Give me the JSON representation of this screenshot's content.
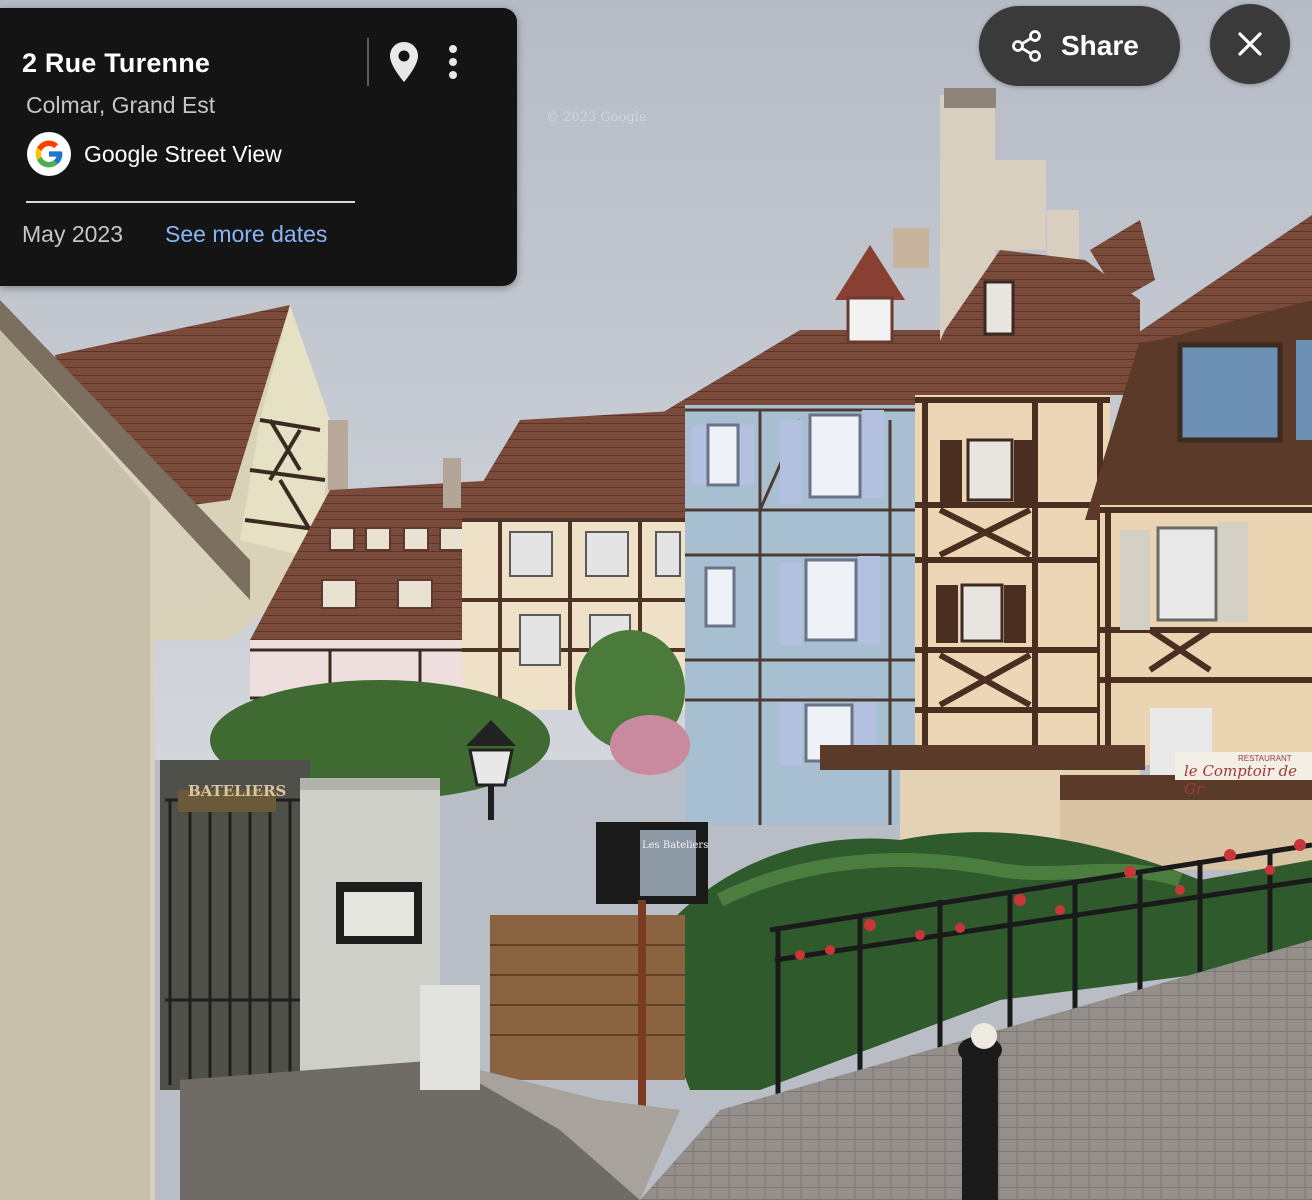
{
  "place": {
    "title": "2 Rue Turenne",
    "subtitle": "Colmar, Grand Est"
  },
  "source": {
    "label": "Google Street View",
    "logo_icon": "google-g-icon"
  },
  "dates": {
    "current": "May 2023",
    "link_label": "See more dates"
  },
  "toolbar": {
    "share_label": "Share",
    "share_icon": "share-icon",
    "close_icon": "close-icon",
    "pin_icon": "map-pin-icon",
    "more_icon": "more-vert-icon"
  },
  "scene": {
    "watermark": "© 2023 Google",
    "signs": {
      "bateliers_wall": "BATELIERS",
      "bateliers_board": "Les Bateliers",
      "comptoir": "le Comptoir de Gr",
      "comptoir_small": "RESTAURANT"
    }
  },
  "colors": {
    "card_bg": "#141414",
    "link": "#8ab4f8",
    "button_bg": "#3a3a3a",
    "sky": "#c7cbd3"
  }
}
